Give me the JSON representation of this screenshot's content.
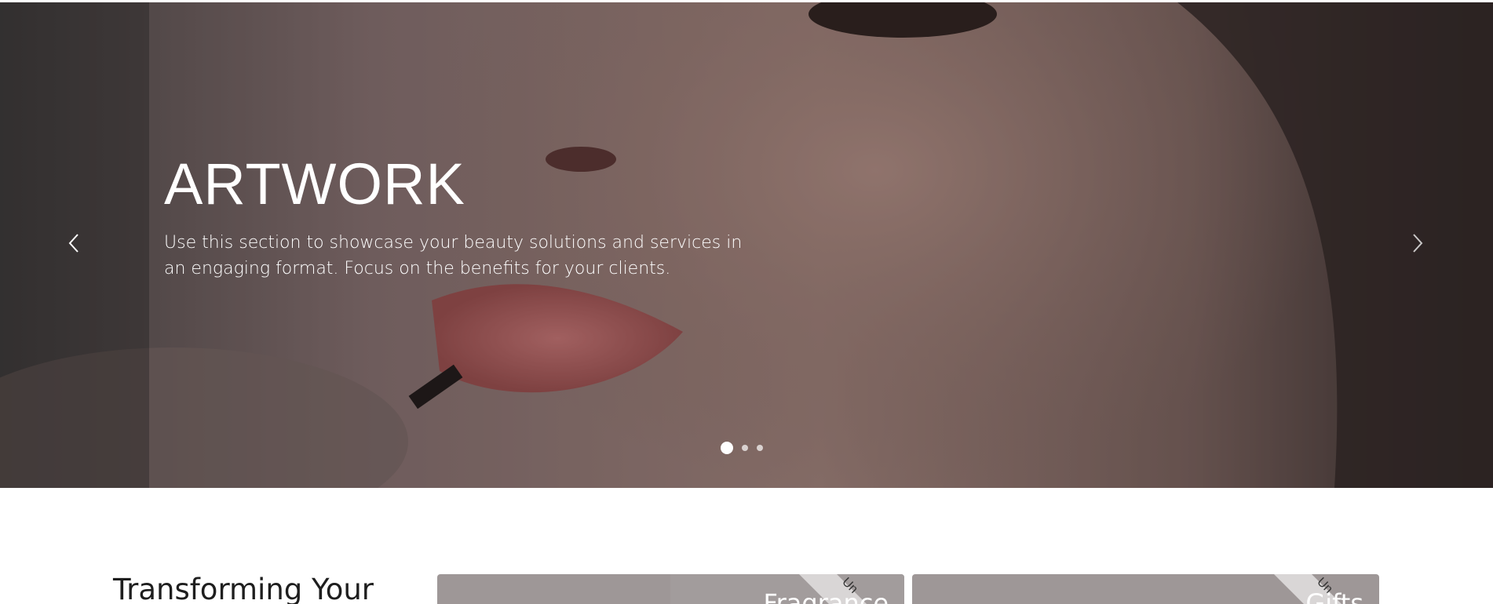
{
  "hero": {
    "title": "ARTWORK",
    "description": "Use this section to showcase your beauty solutions and services in an engaging format. Focus on the benefits for your clients.",
    "slides_total": 3,
    "active_slide": 1
  },
  "section": {
    "title": "Transforming Your"
  },
  "cards": [
    {
      "title": "Fragrance",
      "ribbon": "Un"
    },
    {
      "title": "Gifts",
      "ribbon": "Un"
    }
  ],
  "colors": {
    "card_bg": "#9e9797",
    "overlay": "#281e1e",
    "text_light": "#ffffff"
  },
  "icons": {
    "prev": "chevron-left-icon",
    "next": "chevron-right-icon"
  }
}
